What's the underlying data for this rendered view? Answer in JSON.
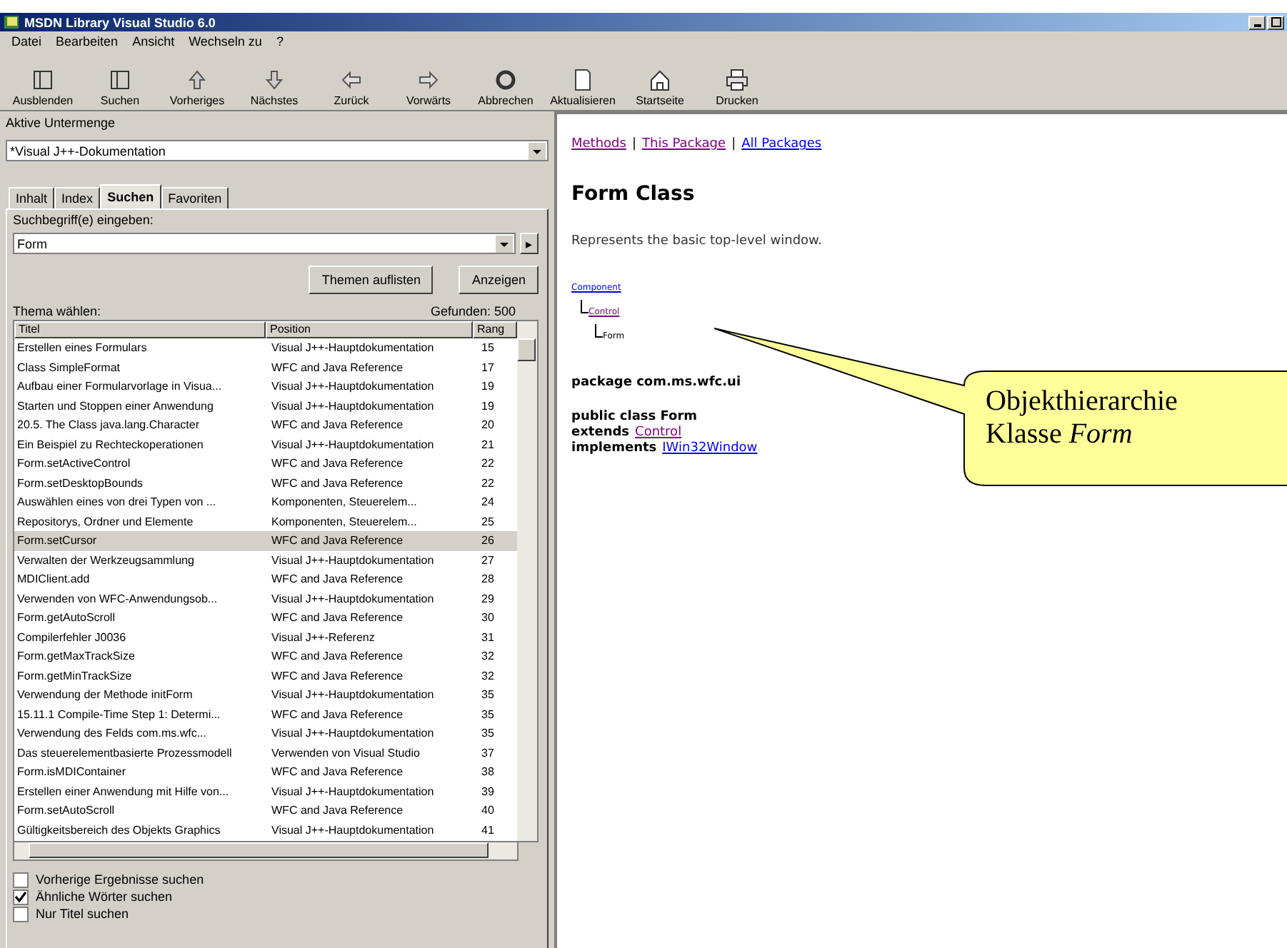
{
  "window": {
    "title": "MSDN Library Visual Studio 6.0"
  },
  "menu": [
    "Datei",
    "Bearbeiten",
    "Ansicht",
    "Wechseln zu",
    "?"
  ],
  "toolbar": [
    {
      "label": "Ausblenden",
      "kind": "hide"
    },
    {
      "label": "Suchen",
      "kind": "search"
    },
    {
      "label": "Vorheriges",
      "kind": "up"
    },
    {
      "label": "Nächstes",
      "kind": "down"
    },
    {
      "label": "Zurück",
      "kind": "back"
    },
    {
      "label": "Vorwärts",
      "kind": "forward"
    },
    {
      "label": "Abbrechen",
      "kind": "stop"
    },
    {
      "label": "Aktualisieren",
      "kind": "refresh"
    },
    {
      "label": "Startseite",
      "kind": "home"
    },
    {
      "label": "Drucken",
      "kind": "print"
    }
  ],
  "subset": {
    "label": "Aktive Untermenge",
    "value": "*Visual J++-Dokumentation"
  },
  "tabs": [
    {
      "label": "Inhalt",
      "selected": false
    },
    {
      "label": "Index",
      "selected": false
    },
    {
      "label": "Suchen",
      "selected": true
    },
    {
      "label": "Favoriten",
      "selected": false
    }
  ],
  "search": {
    "label": "Suchbegriff(e) eingeben:",
    "value": "Form",
    "arrow": "▸"
  },
  "buttons": [
    "Themen auflisten",
    "Anzeigen"
  ],
  "results": {
    "label": "Thema wählen:",
    "found": "Gefunden: 500",
    "columns": [
      "Titel",
      "Position",
      "Rang"
    ],
    "rows": [
      {
        "title": "Erstellen eines Formulars",
        "position": "Visual J++-Hauptdokumentation",
        "rank": "15",
        "selected": false
      },
      {
        "title": "Class SimpleFormat",
        "position": "WFC and Java Reference",
        "rank": "17",
        "selected": false
      },
      {
        "title": "Aufbau einer Formularvorlage in Visua...",
        "position": "Visual J++-Hauptdokumentation",
        "rank": "19",
        "selected": false
      },
      {
        "title": "Starten und Stoppen einer Anwendung",
        "position": "Visual J++-Hauptdokumentation",
        "rank": "19",
        "selected": false
      },
      {
        "title": "20.5. The Class java.lang.Character",
        "position": "WFC and Java Reference",
        "rank": "20",
        "selected": false
      },
      {
        "title": "Ein Beispiel zu Rechteckoperationen",
        "position": "Visual J++-Hauptdokumentation",
        "rank": "21",
        "selected": false
      },
      {
        "title": "Form.setActiveControl",
        "position": "WFC and Java Reference",
        "rank": "22",
        "selected": false
      },
      {
        "title": "Form.setDesktopBounds",
        "position": "WFC and Java Reference",
        "rank": "22",
        "selected": false
      },
      {
        "title": "Auswählen eines von drei Typen von ...",
        "position": "Komponenten, Steuerelem...",
        "rank": "24",
        "selected": false
      },
      {
        "title": "Repositorys, Ordner und Elemente",
        "position": "Komponenten, Steuerelem...",
        "rank": "25",
        "selected": false
      },
      {
        "title": "Form.setCursor",
        "position": "WFC and Java Reference",
        "rank": "26",
        "selected": true
      },
      {
        "title": "Verwalten der Werkzeugsammlung",
        "position": "Visual J++-Hauptdokumentation",
        "rank": "27",
        "selected": false
      },
      {
        "title": "MDIClient.add",
        "position": "WFC and Java Reference",
        "rank": "28",
        "selected": false
      },
      {
        "title": "Verwenden von WFC-Anwendungsob...",
        "position": "Visual J++-Hauptdokumentation",
        "rank": "29",
        "selected": false
      },
      {
        "title": "Form.getAutoScroll",
        "position": "WFC and Java Reference",
        "rank": "30",
        "selected": false
      },
      {
        "title": "Compilerfehler J0036",
        "position": "Visual J++-Referenz",
        "rank": "31",
        "selected": false
      },
      {
        "title": "Form.getMaxTrackSize",
        "position": "WFC and Java Reference",
        "rank": "32",
        "selected": false
      },
      {
        "title": "Form.getMinTrackSize",
        "position": "WFC and Java Reference",
        "rank": "32",
        "selected": false
      },
      {
        "title": "Verwendung der Methode initForm",
        "position": "Visual J++-Hauptdokumentation",
        "rank": "35",
        "selected": false
      },
      {
        "title": "15.11.1 Compile-Time Step 1: Determi...",
        "position": "WFC and Java Reference",
        "rank": "35",
        "selected": false
      },
      {
        "title": "Verwendung des Felds com.ms.wfc...",
        "position": "Visual J++-Hauptdokumentation",
        "rank": "35",
        "selected": false
      },
      {
        "title": "Das steuerelementbasierte Prozessmodell",
        "position": "Verwenden von Visual Studio",
        "rank": "37",
        "selected": false
      },
      {
        "title": "Form.isMDIContainer",
        "position": "WFC and Java Reference",
        "rank": "38",
        "selected": false
      },
      {
        "title": "Erstellen einer Anwendung mit Hilfe von...",
        "position": "Visual J++-Hauptdokumentation",
        "rank": "39",
        "selected": false
      },
      {
        "title": "Form.setAutoScroll",
        "position": "WFC and Java Reference",
        "rank": "40",
        "selected": false
      },
      {
        "title": "Gültigkeitsbereich des Objekts Graphics",
        "position": "Visual J++-Hauptdokumentation",
        "rank": "41",
        "selected": false
      }
    ]
  },
  "options": [
    {
      "label": "Vorherige Ergebnisse suchen",
      "checked": false
    },
    {
      "label": "Ähnliche Wörter suchen",
      "checked": true
    },
    {
      "label": "Nur Titel suchen",
      "checked": false
    }
  ],
  "content": {
    "links": [
      "Methods",
      "This Package",
      "All Packages"
    ],
    "separator": "|",
    "heading": "Form Class",
    "description": "Represents the basic top-level window.",
    "hierarchy": [
      "Component",
      "Control",
      "Form"
    ],
    "package": "package com.ms.wfc.ui",
    "declaration": [
      {
        "text": "public class Form"
      },
      {
        "text": "extends",
        "link": "Control"
      },
      {
        "text": "implements",
        "link": "IWin32Window"
      }
    ]
  },
  "callout": {
    "lines": [
      "Objekthierarchie",
      "Klasse *Form*"
    ]
  }
}
